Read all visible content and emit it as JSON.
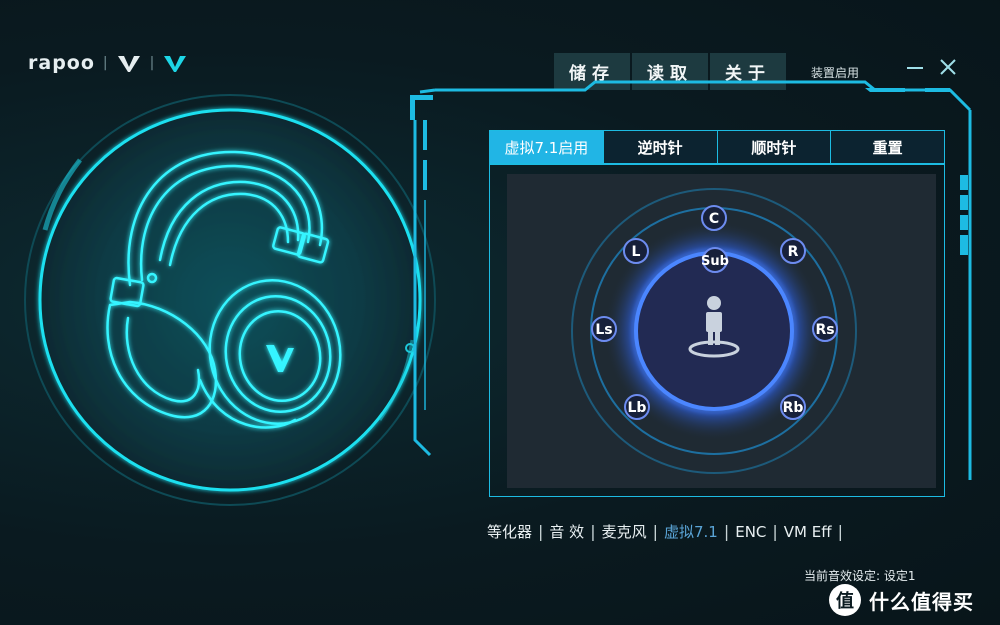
{
  "brand": {
    "name": "rapoo",
    "sep": "|"
  },
  "topmenu": {
    "save": "储存",
    "load": "读取",
    "about": "关于"
  },
  "device": {
    "label": "装置启用"
  },
  "window": {
    "minimize": "—",
    "close": "✕"
  },
  "tabs": [
    {
      "label": "虚拟7.1启用",
      "active": true
    },
    {
      "label": "逆时针",
      "active": false
    },
    {
      "label": "顺时针",
      "active": false
    },
    {
      "label": "重置",
      "active": false
    }
  ],
  "speakers": {
    "c": "C",
    "l": "L",
    "r": "R",
    "sub": "Sub",
    "ls": "Ls",
    "rs": "Rs",
    "lb": "Lb",
    "rb": "Rb"
  },
  "bottom_nav": [
    {
      "label": "等化器",
      "active": false
    },
    {
      "label": "音 效",
      "active": false
    },
    {
      "label": "麦克风",
      "active": false
    },
    {
      "label": "虚拟7.1",
      "active": true
    },
    {
      "label": "ENC",
      "active": false
    },
    {
      "label": "VM Eff",
      "active": false
    }
  ],
  "status": {
    "text": "当前音效设定: 设定1"
  },
  "watermark": {
    "icon": "值",
    "text": "什么值得买"
  },
  "colors": {
    "accent": "#21b5e5",
    "cyan": "#1de0f0",
    "blue": "#3f7bf0",
    "bg": "#0a1a20"
  }
}
